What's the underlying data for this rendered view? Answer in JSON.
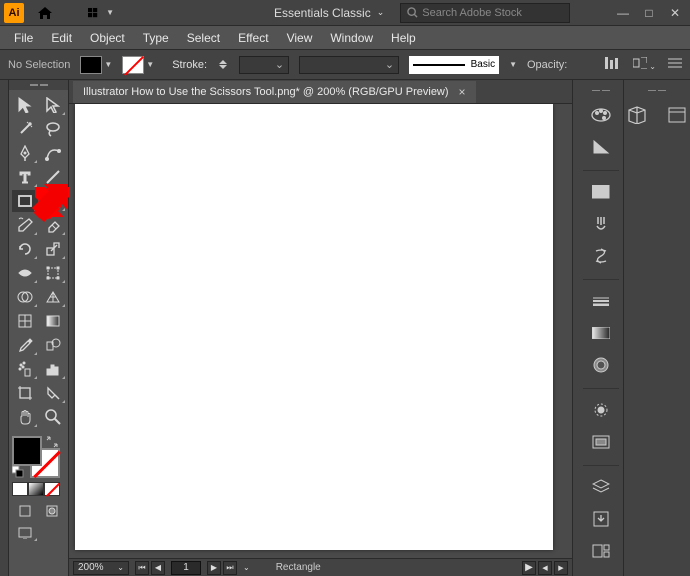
{
  "titlebar": {
    "workspace": "Essentials Classic",
    "search_placeholder": "Search Adobe Stock"
  },
  "menu": {
    "items": [
      "File",
      "Edit",
      "Object",
      "Type",
      "Select",
      "Effect",
      "View",
      "Window",
      "Help"
    ]
  },
  "control": {
    "selection_label": "No Selection",
    "stroke_label": "Stroke:",
    "brush_style": "Basic",
    "opacity_label": "Opacity:"
  },
  "document": {
    "tab_title": "Illustrator How to Use the Scissors Tool.png* @ 200% (RGB/GPU Preview)"
  },
  "status": {
    "zoom": "200%",
    "page": "1",
    "tool_name": "Rectangle"
  },
  "tools": [
    [
      "selection",
      "direct-selection"
    ],
    [
      "magic-wand",
      "lasso"
    ],
    [
      "pen",
      "curvature"
    ],
    [
      "type",
      "line-segment"
    ],
    [
      "rectangle",
      "paintbrush"
    ],
    [
      "shaper",
      "eraser"
    ],
    [
      "rotate",
      "scale"
    ],
    [
      "width",
      "free-transform"
    ],
    [
      "shape-builder",
      "perspective-grid"
    ],
    [
      "mesh",
      "gradient"
    ],
    [
      "eyedropper",
      "blend"
    ],
    [
      "symbol-sprayer",
      "column-graph"
    ],
    [
      "artboard",
      "slice"
    ],
    [
      "hand",
      "zoom"
    ]
  ],
  "panels_col1": [
    "color",
    "color-guide",
    "swatches",
    "brushes",
    "symbols",
    "stroke",
    "gradient",
    "transparency",
    "appearance",
    "graphic-styles",
    "layers",
    "asset-export",
    "artboards"
  ],
  "panels_col2_row": [
    "libraries",
    "properties"
  ]
}
